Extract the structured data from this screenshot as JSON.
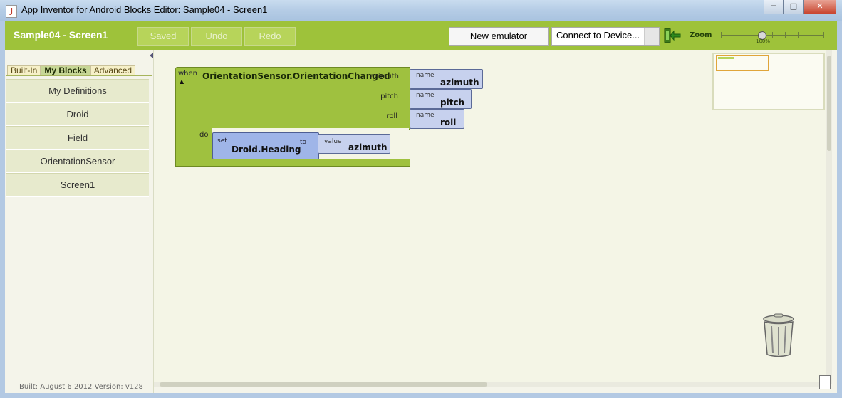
{
  "window": {
    "title": "App Inventor for Android Blocks Editor: Sample04 - Screen1",
    "controls": {
      "minimize": "─",
      "maximize": "□",
      "close": "✕"
    }
  },
  "toolbar": {
    "project_title": "Sample04 - Screen1",
    "saved_label": "Saved",
    "undo_label": "Undo",
    "redo_label": "Redo",
    "new_emulator_label": "New emulator",
    "connect_label": "Connect to Device...",
    "zoom_label": "Zoom",
    "zoom_value": "100%",
    "accent_color": "#9ec23a"
  },
  "sidebar": {
    "tabs": [
      {
        "label": "Built-In",
        "active": false
      },
      {
        "label": "My Blocks",
        "active": true
      },
      {
        "label": "Advanced",
        "active": false
      }
    ],
    "categories": [
      {
        "label": "My Definitions"
      },
      {
        "label": "Droid"
      },
      {
        "label": "Field"
      },
      {
        "label": "OrientationSensor"
      },
      {
        "label": "Screen1"
      }
    ],
    "build_info": "Built: August 6 2012 Version: v128"
  },
  "blocks": {
    "event": {
      "when_label": "when",
      "collapse_glyph": "▲",
      "name": "OrientationSensor.OrientationChanged",
      "do_label": "do",
      "params": [
        {
          "label": "azimuth",
          "name_label": "name",
          "value": "azimuth"
        },
        {
          "label": "pitch",
          "name_label": "name",
          "value": "pitch"
        },
        {
          "label": "roll",
          "name_label": "name",
          "value": "roll"
        }
      ]
    },
    "setter": {
      "set_label": "set",
      "property": "Droid.Heading",
      "to_label": "to",
      "value_label": "value",
      "value": "azimuth"
    }
  },
  "icons": {
    "app": "java-app-icon",
    "emulator_connect": "phone-connect-icon",
    "trash": "trash-can-icon"
  }
}
